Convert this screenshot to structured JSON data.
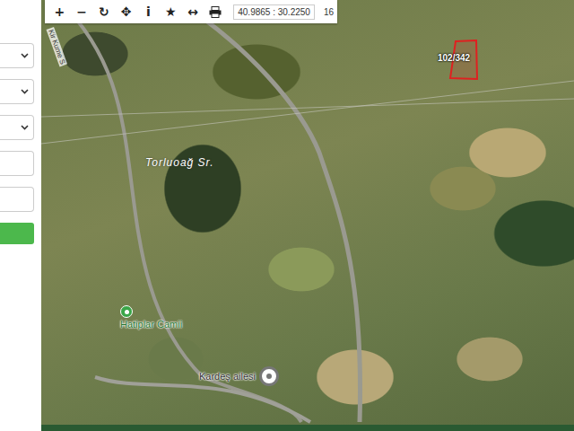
{
  "sidebar": {
    "fields": [
      {
        "kind": "select"
      },
      {
        "kind": "select"
      },
      {
        "kind": "select"
      },
      {
        "kind": "input"
      },
      {
        "kind": "input"
      },
      {
        "kind": "button"
      }
    ]
  },
  "toolbar": {
    "buttons": [
      "+",
      "−",
      "↻",
      "✥",
      "i",
      "★",
      "↔"
    ],
    "coordinates": "40.9865 : 30.2250",
    "zoom": "16"
  },
  "map": {
    "parcel": {
      "label": "102/342"
    },
    "labels": [
      {
        "text": "Torluoağ Sr.",
        "kind": "area"
      },
      {
        "text": "Kir Kume S",
        "kind": "road"
      }
    ],
    "pins": [
      {
        "label": "Hatiplar Camii",
        "kind": "poi",
        "color": "#3aa648"
      },
      {
        "label": "Kardeş ailesi",
        "kind": "place",
        "color": "#ffffff"
      }
    ]
  }
}
